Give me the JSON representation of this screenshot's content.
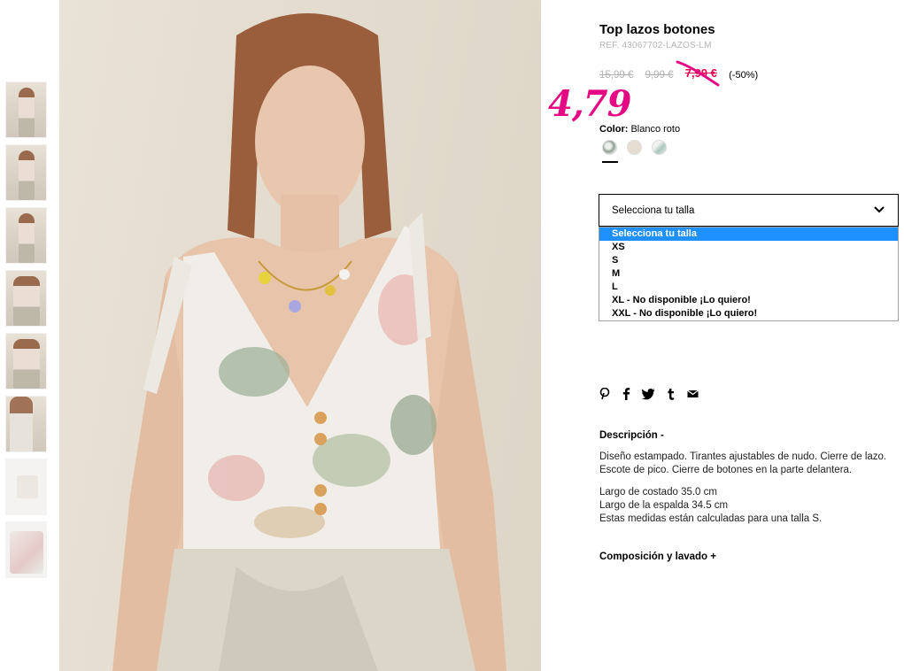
{
  "product": {
    "title": "Top lazos botones",
    "ref": "REF. 43067702-LAZOS-LM",
    "price_original": "15,99 €",
    "price_previous": "9,99 €",
    "price_sale": "7,99 €",
    "discount": "(-50%)",
    "handwritten_price": "4,79"
  },
  "color": {
    "label": "Color:",
    "value": "Blanco roto"
  },
  "size_select": {
    "current": "Selecciona tu talla",
    "options": [
      "Selecciona tu talla",
      "XS",
      "S",
      "M",
      "L",
      "XL - No disponible ¡Lo quiero!",
      "XXL - No disponible ¡Lo quiero!"
    ]
  },
  "description": {
    "heading": "Descripción -",
    "text": "Diseño estampado. Tirantes ajustables de nudo. Cierre de lazo. Escote de pico. Cierre de botones en la parte delantera.",
    "measures": [
      "Largo de costado 35.0 cm",
      "Largo de la espalda 34.5 cm",
      "Estas medidas están calculadas para una talla S."
    ]
  },
  "composition": {
    "heading": "Composición y lavado +"
  },
  "colors": {
    "sale": "#e4004f",
    "handwritten": "#e40a83",
    "dropdown_highlight": "#1e90ff"
  }
}
